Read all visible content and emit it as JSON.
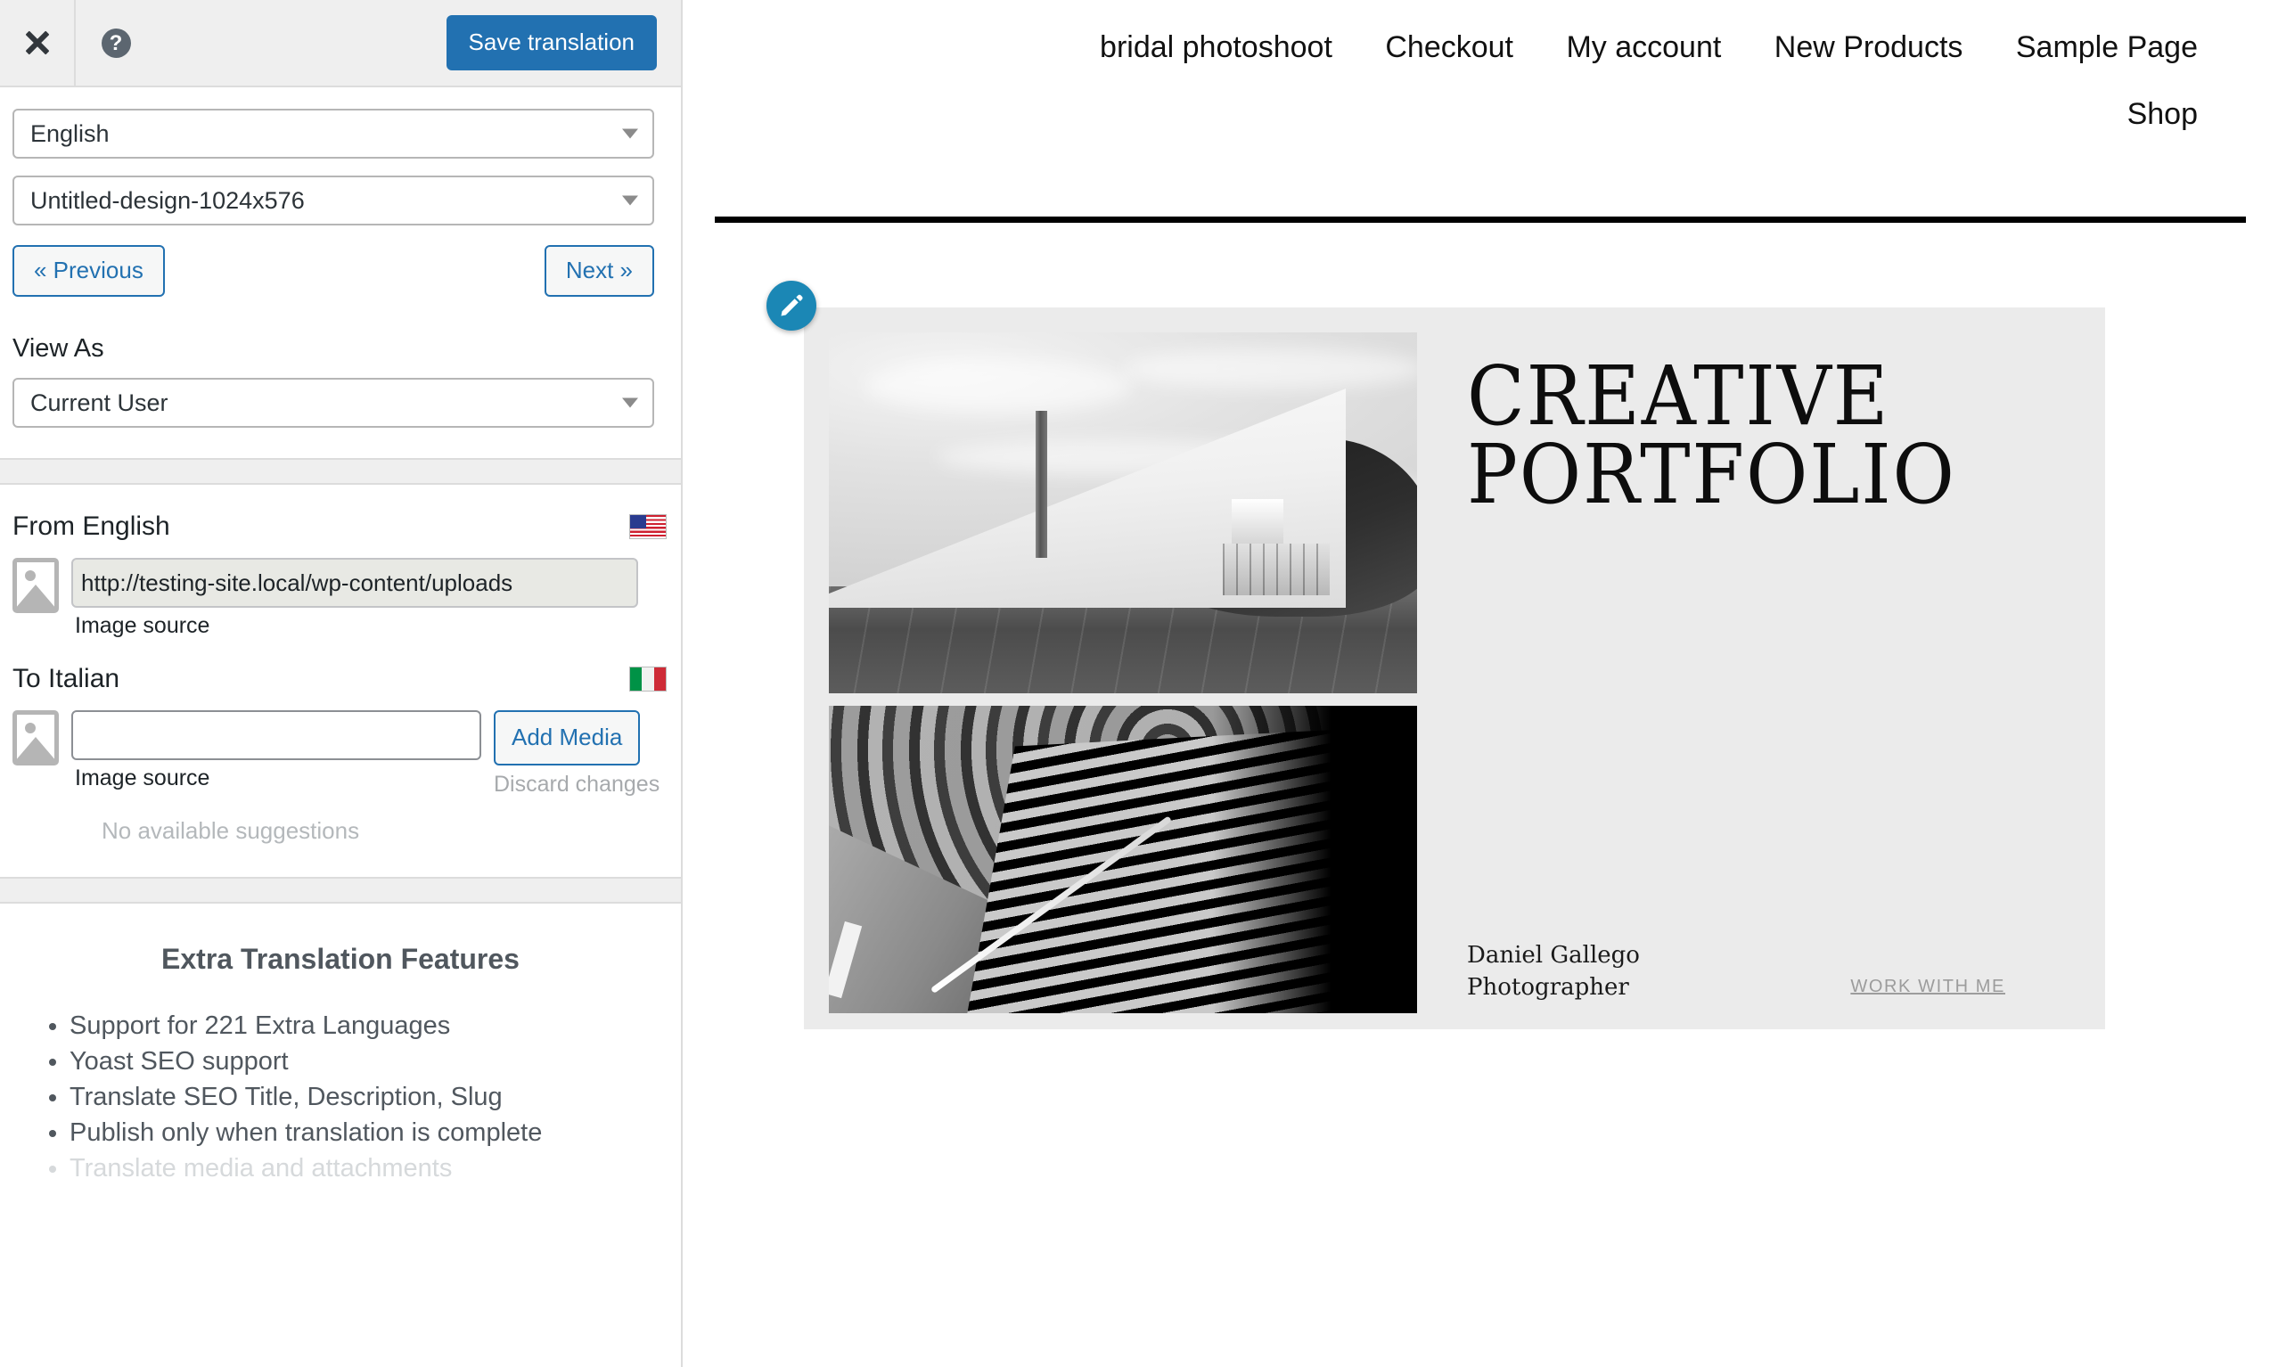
{
  "sidebar": {
    "toolbar": {
      "close_icon": "close-icon",
      "help_icon": "help-icon",
      "help_glyph": "?",
      "save_label": "Save translation"
    },
    "language_select": {
      "value": "English",
      "caret": "chevron-down-icon"
    },
    "item_select": {
      "value": "Untitled-design-1024x576",
      "caret": "chevron-down-icon"
    },
    "nav": {
      "previous_label": "« Previous",
      "next_label": "Next »"
    },
    "view_as": {
      "label": "View As",
      "value": "Current User"
    },
    "from": {
      "title": "From English",
      "flag": "us-flag-icon",
      "image_icon": "image-icon",
      "source_value": "http://testing-site.local/wp-content/uploads",
      "source_label": "Image source"
    },
    "to": {
      "title": "To Italian",
      "flag": "italy-flag-icon",
      "image_icon": "image-icon",
      "source_value": "",
      "source_placeholder": "",
      "source_label": "Image source",
      "add_media_label": "Add Media",
      "discard_label": "Discard changes",
      "suggestions_text": "No available suggestions"
    },
    "promo": {
      "title": "Extra Translation Features",
      "features": [
        "Support for 221 Extra Languages",
        "Yoast SEO support",
        "Translate SEO Title, Description, Slug",
        "Publish only when translation is complete",
        "Translate media and attachments"
      ]
    }
  },
  "preview": {
    "nav_row1": [
      "bridal photoshoot",
      "Checkout",
      "My account",
      "New Products",
      "Sample Page"
    ],
    "nav_row2": [
      "Shop"
    ],
    "edit_button_icon": "pencil-icon",
    "card": {
      "title_line1": "CREATIVE",
      "title_line2": "PORTFOLIO",
      "author_name": "Daniel Gallego",
      "author_role": "Photographer",
      "cta_label": "WORK WITH ME",
      "photo_top_alt": "white concrete canopy building",
      "photo_bottom_alt": "concrete staircase under vaulted ribs"
    }
  },
  "colors": {
    "accent_blue": "#2271b1",
    "fab_blue": "#1b87b5",
    "toolbar_bg": "#efefef",
    "card_bg": "#ebebeb",
    "muted": "#a7aaad"
  }
}
